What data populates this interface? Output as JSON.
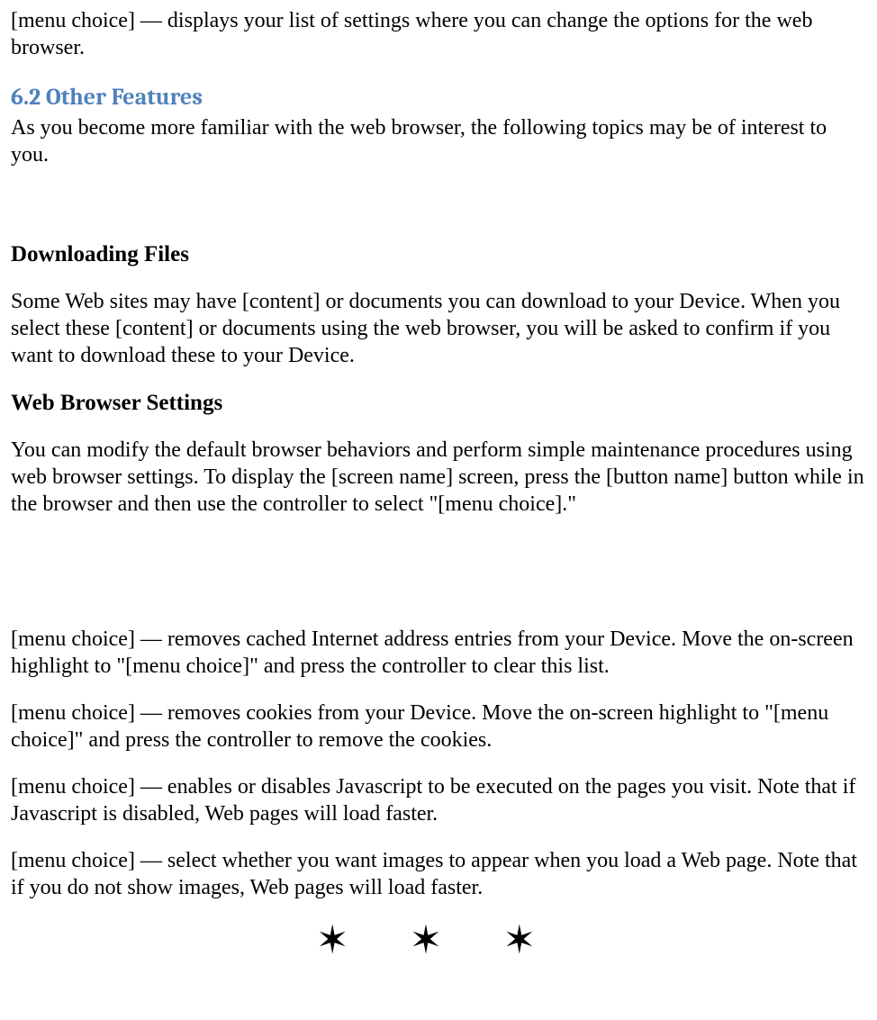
{
  "intro_menu_choice": "[menu choice] — displays your list of settings where you can change the options for the web browser.",
  "section_heading": "6.2 Other Features",
  "section_intro": "As you become more familiar with the web browser, the following topics may be of interest to you.",
  "downloading_heading": "Downloading Files",
  "downloading_body": "Some Web sites may have [content] or documents you can download to your Device. When you select these [content] or documents using the web browser, you will be asked to confirm if you want to download these to your Device.",
  "settings_heading": "Web Browser Settings",
  "settings_body": "You can modify the default browser behaviors and perform simple maintenance procedures using web browser settings. To display the [screen name] screen, press the [button name] button while in the browser and then use the controller to select \"[menu choice].\"",
  "menu_items": [
    "[menu choice] — removes cached Internet address entries from your Device. Move the on-screen highlight to \"[menu choice]\" and press the controller to clear this list.",
    "[menu choice] — removes cookies from your Device. Move the on-screen highlight to \"[menu choice]\" and press the controller to remove the cookies.",
    "[menu choice] — enables or disables Javascript to be executed on the pages you visit. Note that if Javascript is disabled, Web pages will load faster.",
    "[menu choice] — select whether you want images to appear when you load a Web page. Note that if you do not show images, Web pages will load faster."
  ],
  "divider": "✶ ✶ ✶"
}
